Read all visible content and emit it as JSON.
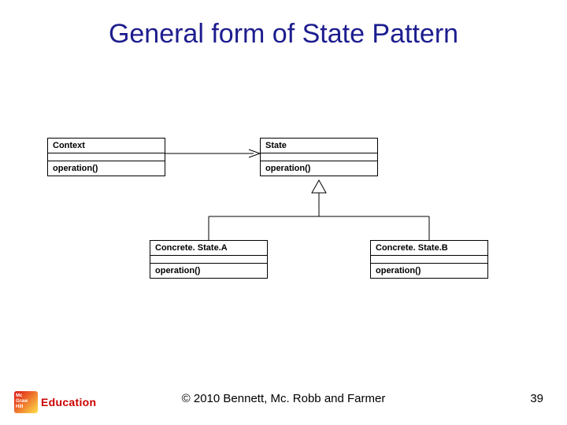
{
  "title": "General form of State Pattern",
  "classes": {
    "context": {
      "name": "Context",
      "op": "operation()"
    },
    "state": {
      "name": "State",
      "op": "operation()"
    },
    "concA": {
      "name": "Concrete. State.A",
      "op": "operation()"
    },
    "concB": {
      "name": "Concrete. State.B",
      "op": "operation()"
    }
  },
  "footer": {
    "copyright": "© 2010 Bennett, Mc. Robb and Farmer",
    "page": "39"
  },
  "logo": {
    "text": "Education"
  }
}
